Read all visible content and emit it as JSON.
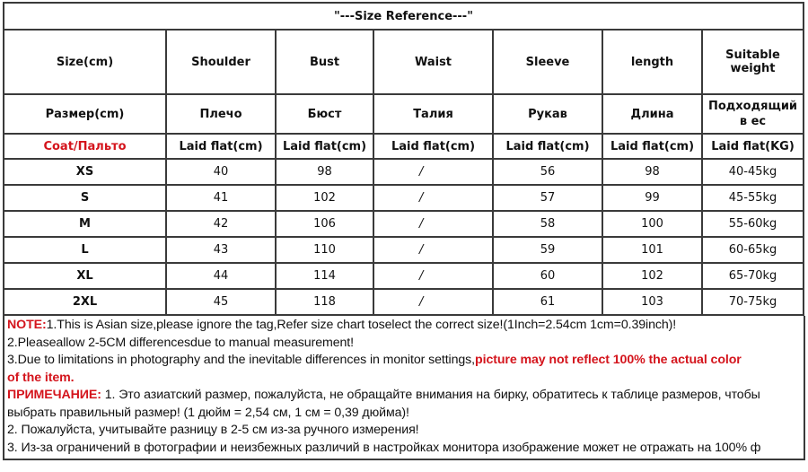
{
  "title": "\"---Size Reference---\"",
  "header_en": [
    "Size(cm)",
    "Shoulder",
    "Bust",
    "Waist",
    "Sleeve",
    "length",
    "Suitable weight"
  ],
  "header_ru": [
    "Размер(cm)",
    "Плечо",
    "Бюст",
    "Талия",
    "Рукав",
    "Длина",
    "Подходящий в ес"
  ],
  "header_unit": [
    "Coat/Пальто",
    "Laid flat(cm)",
    "Laid flat(cm)",
    "Laid flat(cm)",
    "Laid flat(cm)",
    "Laid flat(cm)",
    "Laid flat(KG)"
  ],
  "rows": [
    {
      "size": "XS",
      "shoulder": "40",
      "bust": "98",
      "waist": "/",
      "sleeve": "56",
      "length": "98",
      "weight": "40-45kg"
    },
    {
      "size": "S",
      "shoulder": "41",
      "bust": "102",
      "waist": "/",
      "sleeve": "57",
      "length": "99",
      "weight": "45-55kg"
    },
    {
      "size": "M",
      "shoulder": "42",
      "bust": "106",
      "waist": "/",
      "sleeve": "58",
      "length": "100",
      "weight": "55-60kg"
    },
    {
      "size": "L",
      "shoulder": "43",
      "bust": "110",
      "waist": "/",
      "sleeve": "59",
      "length": "101",
      "weight": "60-65kg"
    },
    {
      "size": "XL",
      "shoulder": "44",
      "bust": "114",
      "waist": "/",
      "sleeve": "60",
      "length": "102",
      "weight": "65-70kg"
    },
    {
      "size": "2XL",
      "shoulder": "45",
      "bust": "118",
      "waist": "/",
      "sleeve": "61",
      "length": "103",
      "weight": "70-75kg"
    }
  ],
  "notes": {
    "en_label": "NOTE:",
    "en_1": "1.This is Asian size,please ignore the tag,Refer size chart toselect the correct size!(1Inch=2.54cm 1cm=0.39inch)!",
    "en_2": "2.Pleaseallow 2-5CM differencesdue to manual measurement!",
    "en_3_plain": "3.Due to limitations in photography and the inevitable differences in monitor settings,",
    "en_3_red": "picture may not reflect 100% the actual color",
    "en_3_red_cont": "of the item.",
    "ru_label": "ПРИМЕЧАНИЕ:",
    "ru_1": " 1. Это азиатский размер, пожалуйста, не обращайте внимания на бирку, обратитесь к таблице размеров, чтобы",
    "ru_1_cont": "выбрать правильный размер! (1 дюйм = 2,54 см, 1 см = 0,39 дюйма)!",
    "ru_2": "2. Пожалуйста, учитывайте разницу в 2-5 см из-за ручного измерения!",
    "ru_3": "3. Из-за ограничений в фотографии и неизбежных различий в настройках монитора изображение может не отражать на 100% ф"
  },
  "colors": {
    "accent_red": "#d4141c",
    "border": "#3a3a3a"
  }
}
